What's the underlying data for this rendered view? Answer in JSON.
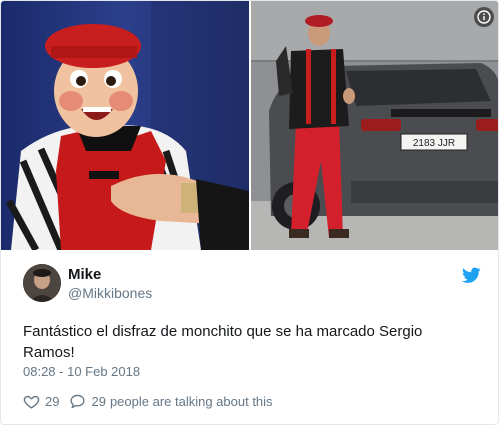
{
  "tweet": {
    "author": {
      "display_name": "Mike",
      "handle": "@Mikkibones",
      "avatar_icon": "user-avatar"
    },
    "text_line1": "Fantástico el disfraz de monchito que se ha marcado Sergio",
    "text_line2": "Ramos!",
    "timestamp": "08:28 - 10 Feb 2018",
    "likes": "29",
    "replies": "29",
    "talking_label": "people are talking about this",
    "license_plate": "2183 JJR"
  },
  "icons": {
    "brand": "twitter-bird-icon",
    "info": "info-icon",
    "like": "heart-icon",
    "reply": "reply-bubble-icon"
  },
  "colors": {
    "twitter_blue": "#1da1f2",
    "secondary_text": "#657786",
    "primary_text": "#14171a",
    "border": "#e1e8ed"
  }
}
